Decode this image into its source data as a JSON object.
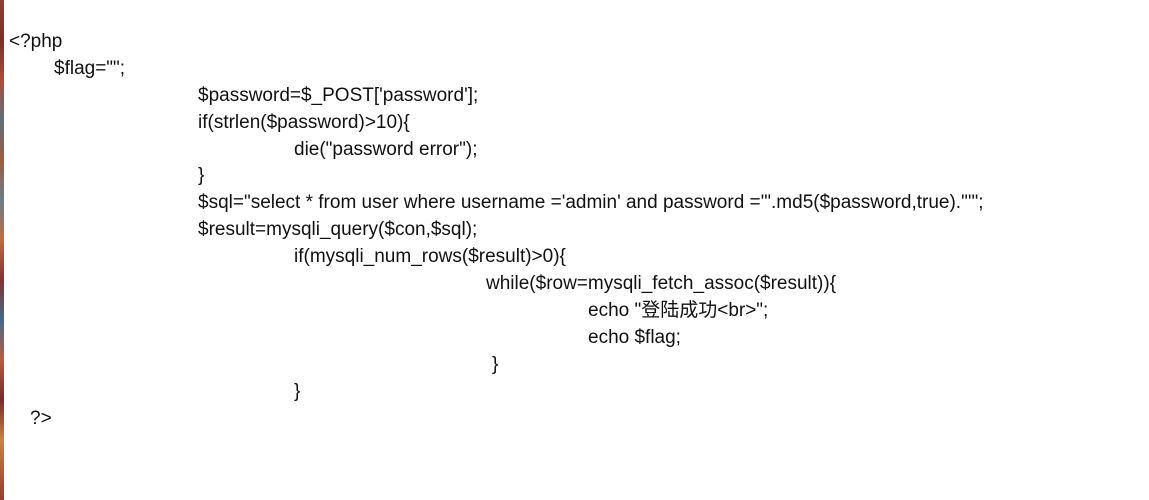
{
  "code": {
    "lines": [
      "<?php",
      "$flag=\"\";",
      "$password=$_POST['password'];",
      "if(strlen($password)>10){",
      "die(\"password error\");",
      "}",
      "$sql=\"select * from user where username ='admin' and password ='\".md5($password,true).\"'\";",
      "$result=mysqli_query($con,$sql);",
      "if(mysqli_num_rows($result)>0){",
      "while($row=mysqli_fetch_assoc($result)){",
      "echo \"登陆成功<br>\";",
      "echo $flag;",
      "}",
      "}",
      "?>"
    ]
  }
}
